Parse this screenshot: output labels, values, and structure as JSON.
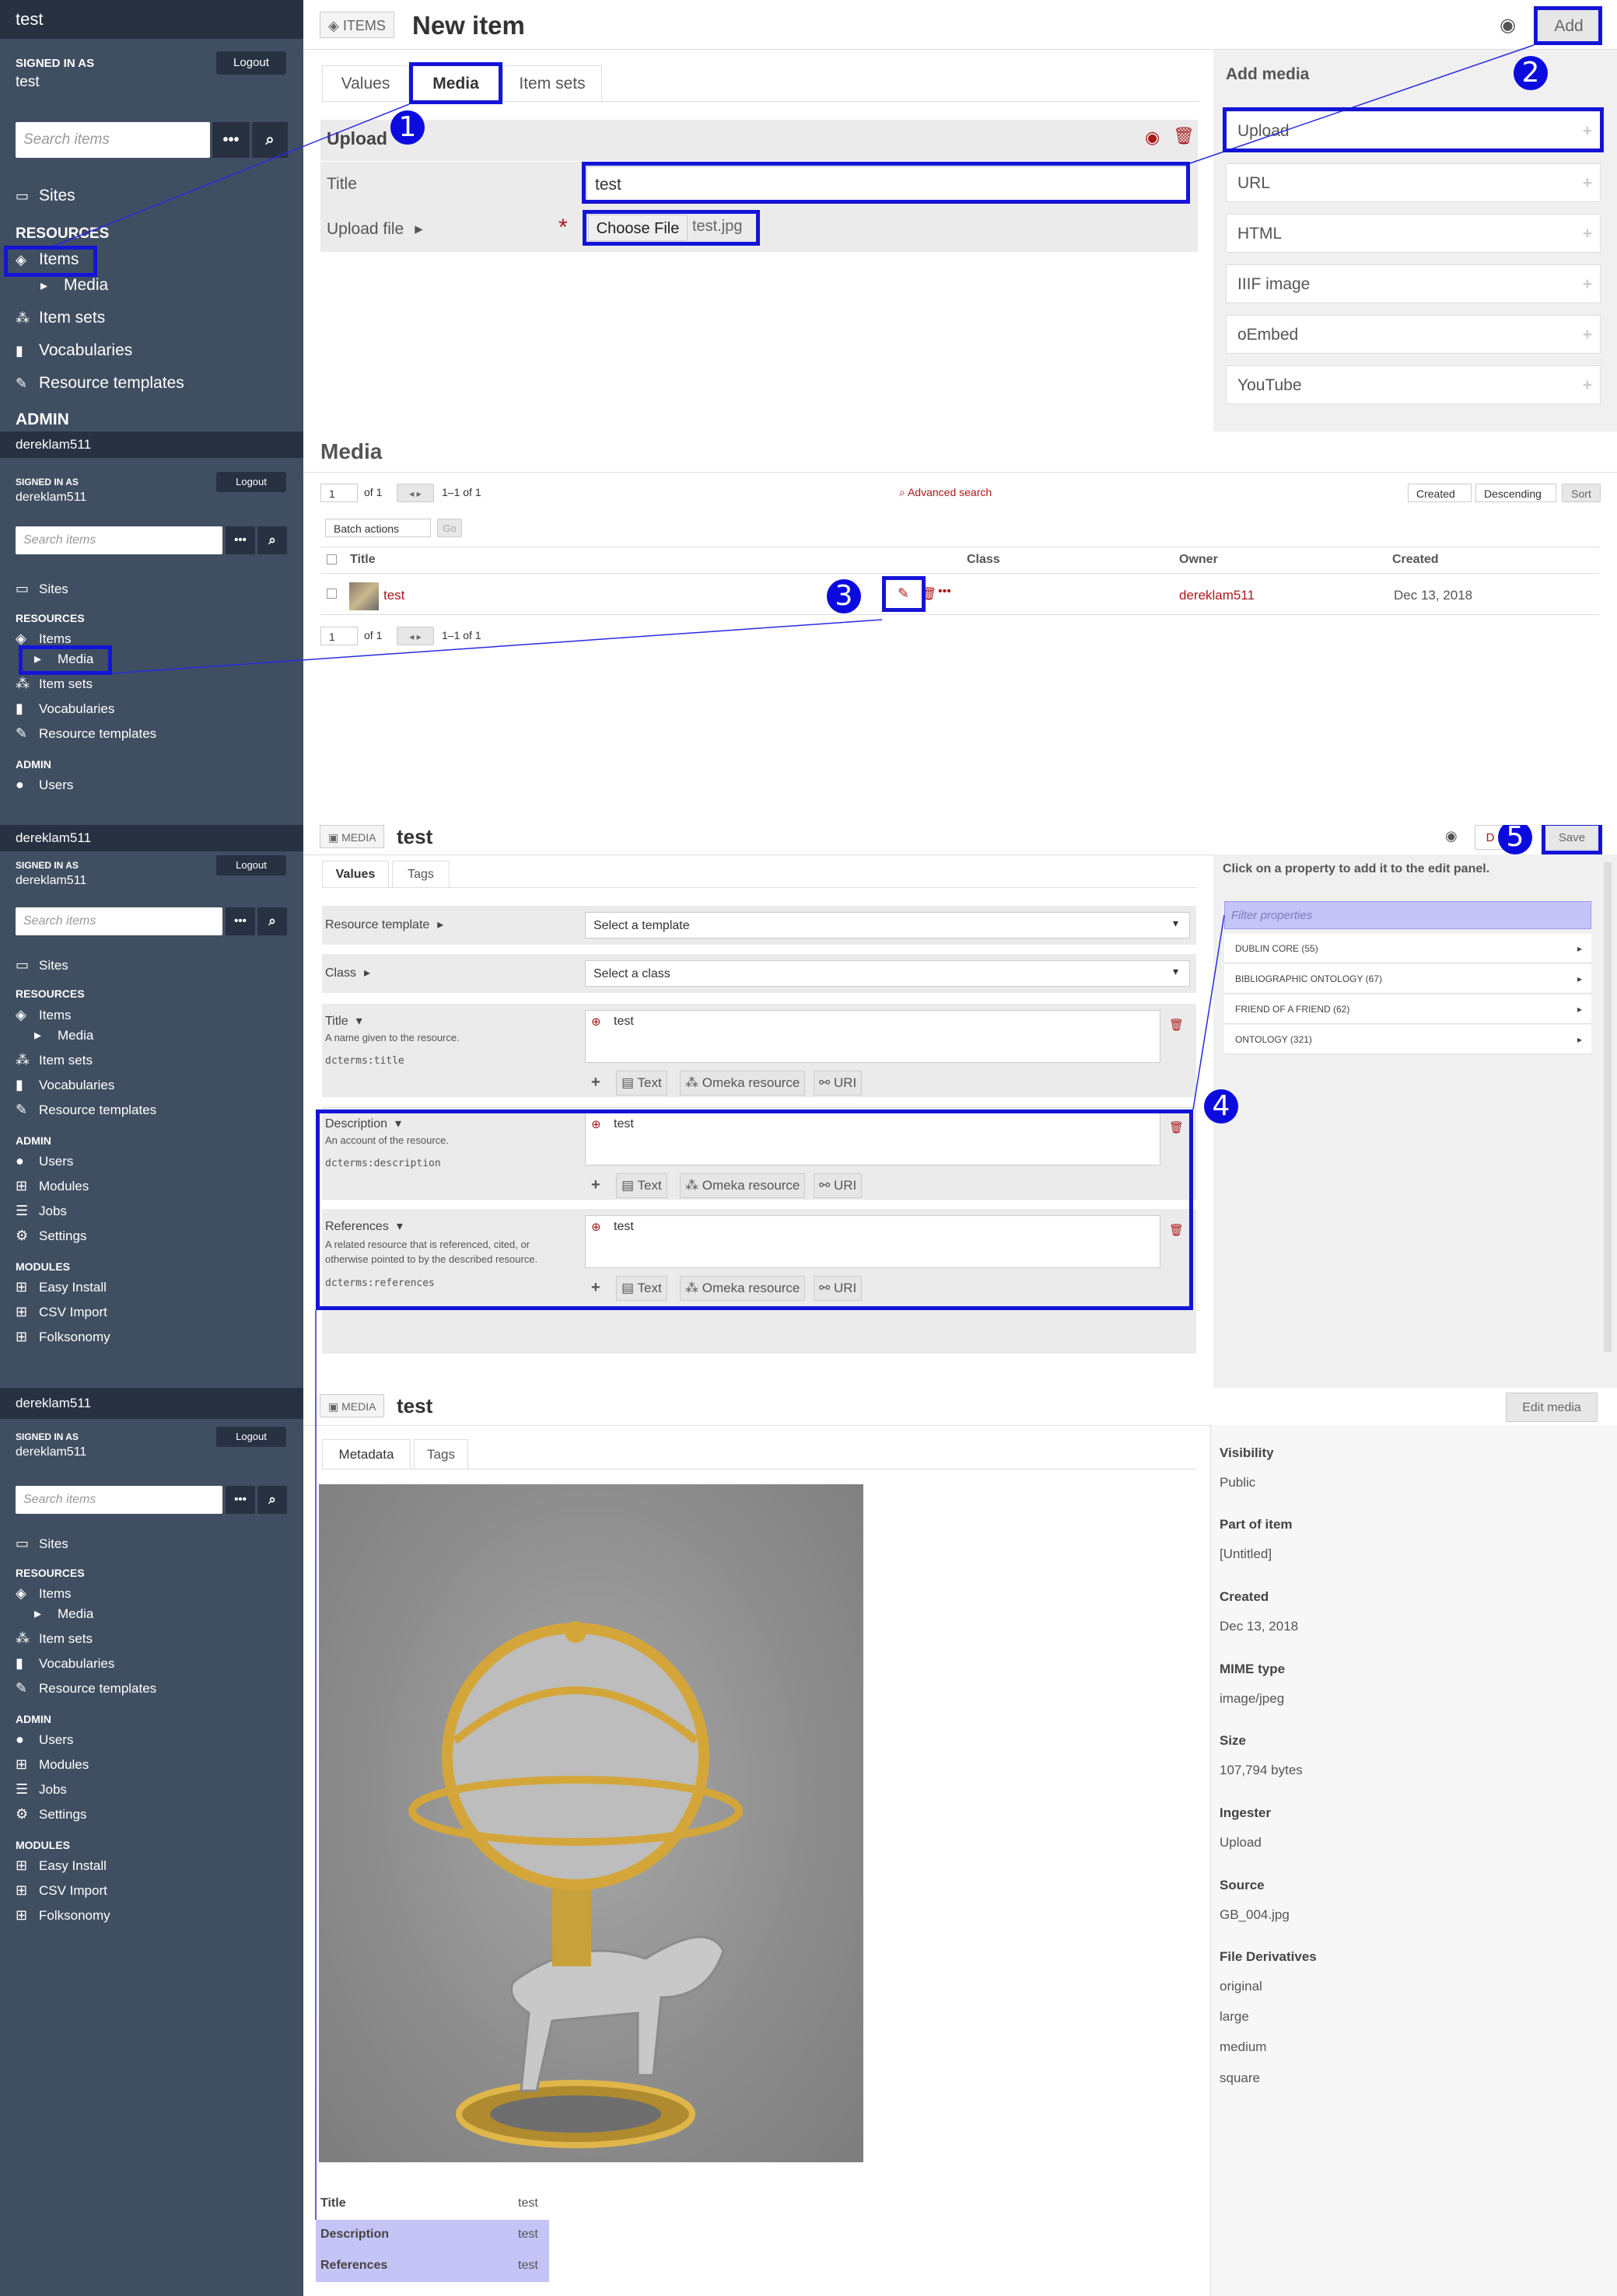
{
  "sidebar": {
    "site_name": "test",
    "signed_in_as": "SIGNED IN AS",
    "logout": "Logout",
    "search_placeholder": "Search items",
    "more_icon": "•••",
    "sections": {
      "resources": "RESOURCES",
      "admin": "ADMIN",
      "modules": "MODULES"
    },
    "items": {
      "sites": "Sites",
      "items": "Items",
      "media": "Media",
      "item_sets": "Item sets",
      "vocabularies": "Vocabularies",
      "resource_templates": "Resource templates",
      "users": "Users",
      "modules": "Modules",
      "jobs": "Jobs",
      "settings": "Settings",
      "easy_install": "Easy Install",
      "csv_import": "CSV Import",
      "folksonomy": "Folksonomy"
    },
    "users": [
      "test",
      "dereklam511"
    ]
  },
  "step_numbers": [
    "1",
    "2",
    "3",
    "4",
    "5"
  ],
  "panel1": {
    "badge": "ITEMS",
    "title": "New item",
    "add_button": "Add",
    "tabs": [
      "Values",
      "Media",
      "Item sets"
    ],
    "upload": {
      "header": "Upload",
      "title_label": "Title",
      "title_value": "test",
      "upload_file_label": "Upload file",
      "required": "*",
      "choose_file": "Choose File",
      "file_name": "test.jpg"
    },
    "add_media": {
      "header": "Add media",
      "options": [
        "Upload",
        "URL",
        "HTML",
        "IIIF image",
        "oEmbed",
        "YouTube"
      ]
    }
  },
  "panel2": {
    "title": "Media",
    "page": "1",
    "of": "of 1",
    "range": "1–1 of 1",
    "advanced_search": "Advanced search",
    "sort_field": "Created",
    "sort_order": "Descending",
    "sort_button": "Sort",
    "batch_actions": "Batch actions",
    "go": "Go",
    "columns": [
      "Title",
      "Class",
      "Owner",
      "Created"
    ],
    "row": {
      "title": "test",
      "owner": "dereklam511",
      "created": "Dec 13, 2018"
    }
  },
  "panel3": {
    "badge": "MEDIA",
    "title": "test",
    "delete_partial": "D",
    "save": "Save",
    "tabs": [
      "Values",
      "Tags"
    ],
    "resource_template": {
      "label": "Resource template",
      "value": "Select a template"
    },
    "class": {
      "label": "Class",
      "value": "Select a class"
    },
    "properties": [
      {
        "label": "Title",
        "desc": "A name given to the resource.",
        "term": "dcterms:title",
        "value": "test"
      },
      {
        "label": "Description",
        "desc": "An account of the resource.",
        "term": "dcterms:description",
        "value": "test"
      },
      {
        "label": "References",
        "desc": "A related resource that is referenced, cited, or otherwise pointed to by the described resource.",
        "term": "dcterms:references",
        "value": "test"
      }
    ],
    "value_types": [
      "Text",
      "Omeka resource",
      "URI"
    ],
    "side": {
      "hint": "Click on a property to add it to the edit panel.",
      "filter_placeholder": "Filter properties",
      "vocabs": [
        "DUBLIN CORE (55)",
        "BIBLIOGRAPHIC ONTOLOGY (67)",
        "FRIEND OF A FRIEND (62)",
        "ONTOLOGY (321)"
      ]
    }
  },
  "panel4": {
    "badge": "MEDIA",
    "title": "test",
    "edit_media": "Edit media",
    "tabs": [
      "Metadata",
      "Tags"
    ],
    "properties": [
      {
        "label": "Title",
        "value": "test"
      },
      {
        "label": "Description",
        "value": "test"
      },
      {
        "label": "References",
        "value": "test"
      }
    ],
    "meta": [
      {
        "label": "Visibility",
        "value": "Public"
      },
      {
        "label": "Part of item",
        "value": "[Untitled]"
      },
      {
        "label": "Created",
        "value": "Dec 13, 2018"
      },
      {
        "label": "MIME type",
        "value": "image/jpeg"
      },
      {
        "label": "Size",
        "value": "107,794 bytes"
      },
      {
        "label": "Ingester",
        "value": "Upload"
      },
      {
        "label": "Source",
        "value": "GB_004.jpg"
      }
    ],
    "derivatives_label": "File Derivatives",
    "derivatives": [
      "original",
      "large",
      "medium",
      "square"
    ]
  }
}
